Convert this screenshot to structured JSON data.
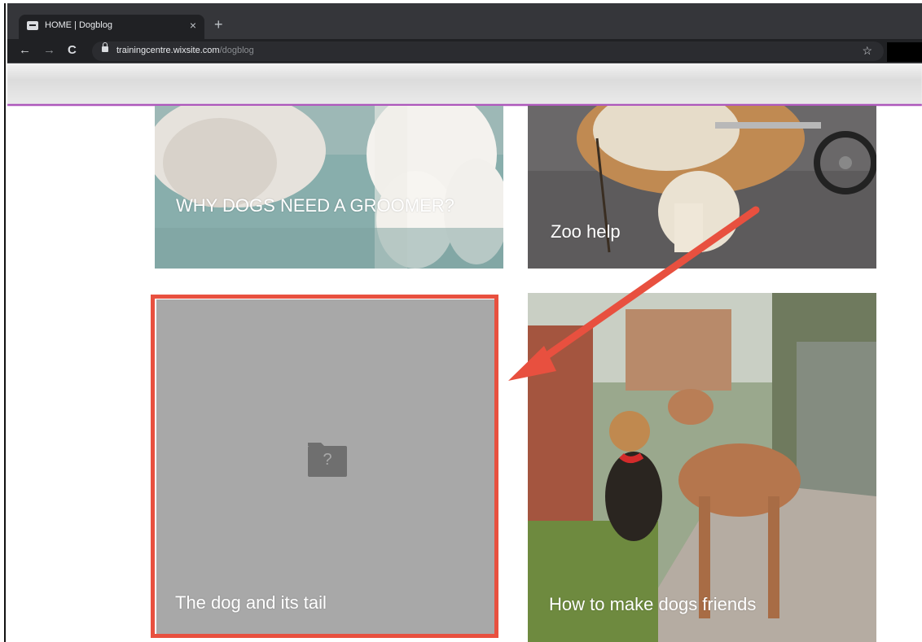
{
  "browser": {
    "tab_title": "HOME | Dogblog",
    "tab_close": "×",
    "new_tab": "+",
    "back": "←",
    "forward": "→",
    "reload": "C",
    "url_domain": "trainingcentre.wixsite.com",
    "url_path": "/dogblog",
    "bookmark_star": "☆"
  },
  "posts": [
    {
      "title": "WHY DOGS NEED A GROOMER?"
    },
    {
      "title": "Zoo help"
    },
    {
      "title": "The dog and its tail"
    },
    {
      "title": "How to make dogs friends"
    }
  ],
  "missing_image_symbol": "?",
  "colors": {
    "highlight": "#e8503f",
    "header_accent": "#9b2fae"
  }
}
